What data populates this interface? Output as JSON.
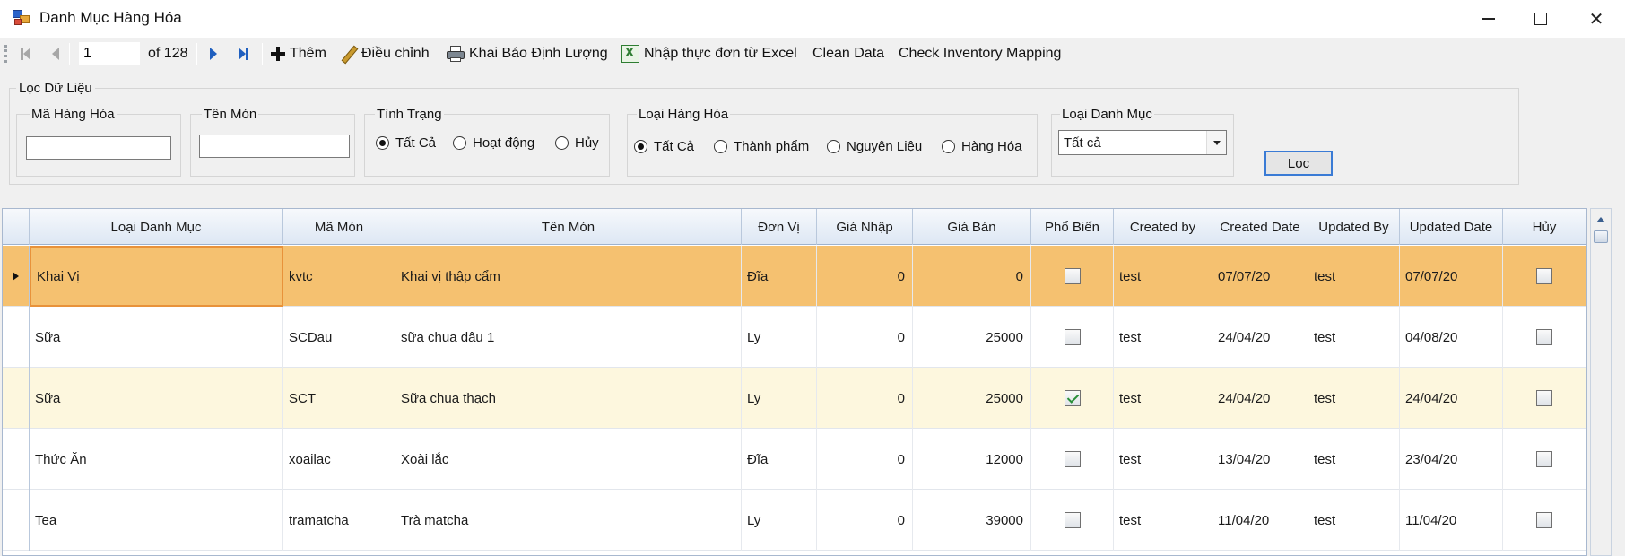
{
  "window": {
    "title": "Danh Mục Hàng Hóa",
    "controls": {
      "minimize_icon": "minimize-icon",
      "maximize_icon": "maximize-icon",
      "close_glyph": "✕"
    }
  },
  "toolbar": {
    "position": "1",
    "count_text": "of 128",
    "add_label": "Thêm",
    "edit_label": "Điều chỉnh",
    "quantity_label": "Khai Báo Định Lượng",
    "import_label": "Nhập thực đơn từ Excel",
    "clean_label": "Clean Data",
    "mapping_label": "Check Inventory Mapping"
  },
  "filter": {
    "legend": "Lọc Dữ Liệu",
    "code_label": "Mã Hàng Hóa",
    "code_value": "",
    "name_label": "Tên Món",
    "name_value": "",
    "status": {
      "legend": "Tình Trạng",
      "options": [
        "Tất Cả",
        "Hoạt động",
        "Hủy"
      ],
      "selected": "Tất Cả"
    },
    "item_type": {
      "legend": "Loại Hàng Hóa",
      "options": [
        "Tất Cả",
        "Thành phẩm",
        "Nguyên Liệu",
        "Hàng Hóa"
      ],
      "selected": "Tất Cả"
    },
    "category": {
      "legend": "Loại Danh Mục",
      "selected": "Tất cả"
    },
    "button_label": "Lọc"
  },
  "grid": {
    "columns": [
      "Loại Danh Mục",
      "Mã Món",
      "Tên Món",
      "Đơn Vị",
      "Giá Nhập",
      "Giá Bán",
      "Phổ Biến",
      "Created by",
      "Created Date",
      "Updated By",
      "Updated Date",
      "Hủy"
    ],
    "rows": [
      {
        "category": "Khai Vị",
        "code": "kvtc",
        "name": "Khai vị thập cẩm",
        "unit": "Đĩa",
        "cost": "0",
        "price": "0",
        "popular": false,
        "created_by": "test",
        "created_date": "07/07/20",
        "updated_by": "test",
        "updated_date": "07/07/20",
        "cancelled": false
      },
      {
        "category": "Sữa",
        "code": "SCDau",
        "name": "sữa chua dâu 1",
        "unit": "Ly",
        "cost": "0",
        "price": "25000",
        "popular": false,
        "created_by": "test",
        "created_date": "24/04/20",
        "updated_by": "test",
        "updated_date": "04/08/20",
        "cancelled": false
      },
      {
        "category": "Sữa",
        "code": "SCT",
        "name": "Sữa chua thạch",
        "unit": "Ly",
        "cost": "0",
        "price": "25000",
        "popular": true,
        "created_by": "test",
        "created_date": "24/04/20",
        "updated_by": "test",
        "updated_date": "24/04/20",
        "cancelled": false
      },
      {
        "category": "Thức Ăn",
        "code": "xoailac",
        "name": "Xoài lắc",
        "unit": "Đĩa",
        "cost": "0",
        "price": "12000",
        "popular": false,
        "created_by": "test",
        "created_date": "13/04/20",
        "updated_by": "test",
        "updated_date": "23/04/20",
        "cancelled": false
      },
      {
        "category": "Tea",
        "code": "tramatcha",
        "name": "Trà matcha",
        "unit": "Ly",
        "cost": "0",
        "price": "39000",
        "popular": false,
        "created_by": "test",
        "created_date": "11/04/20",
        "updated_by": "test",
        "updated_date": "11/04/20",
        "cancelled": false
      }
    ]
  },
  "colors": {
    "selected_row": "#f5c170",
    "alt_row": "#fdf7de",
    "normal_row": "#ffffff",
    "accent": "#3a7bd5"
  }
}
